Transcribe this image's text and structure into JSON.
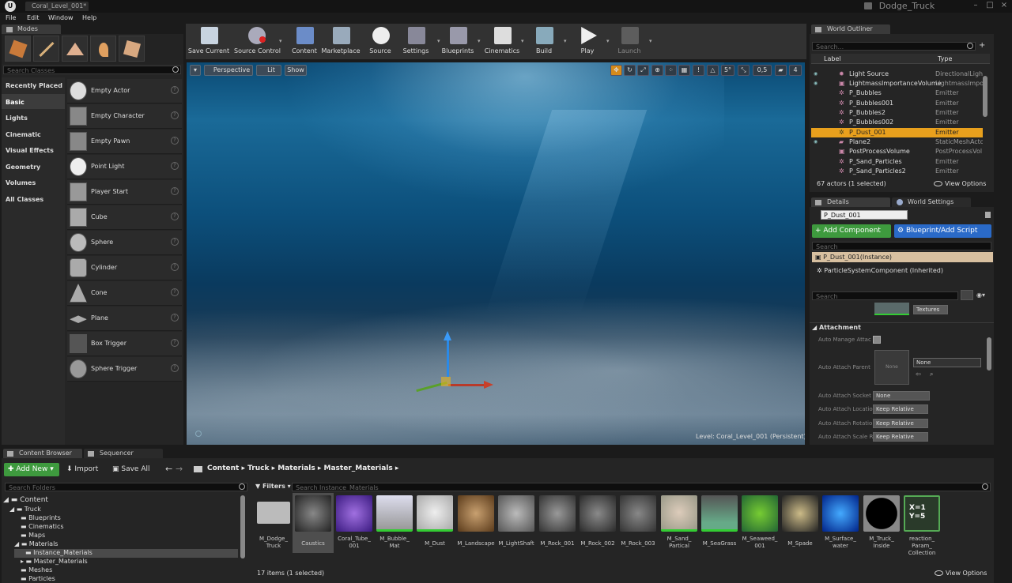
{
  "title_bar": {
    "tab": "Coral_Level_001*",
    "project": "Dodge_Truck"
  },
  "menu": [
    "File",
    "Edit",
    "Window",
    "Help"
  ],
  "modes": {
    "tab": "Modes",
    "search_placeholder": "Search Classes",
    "categories": [
      "Recently Placed",
      "Basic",
      "Lights",
      "Cinematic",
      "Visual Effects",
      "Geometry",
      "Volumes",
      "All Classes"
    ],
    "items": [
      "Empty Actor",
      "Empty Character",
      "Empty Pawn",
      "Point Light",
      "Player Start",
      "Cube",
      "Sphere",
      "Cylinder",
      "Cone",
      "Plane",
      "Box Trigger",
      "Sphere Trigger"
    ]
  },
  "toolbar": [
    "Save Current",
    "Source Control",
    "Content",
    "Marketplace",
    "Source",
    "Settings",
    "Blueprints",
    "Cinematics",
    "Build",
    "Play",
    "Launch"
  ],
  "viewport": {
    "perspective": "Perspective",
    "lit": "Lit",
    "show": "Show",
    "snap_angle": "5°",
    "snap_scale": "0,5",
    "camera_speed": "4",
    "level_label": "Level:",
    "level_name": "Coral_Level_001 (Persistent)"
  },
  "outliner": {
    "tab": "World Outliner",
    "search_placeholder": "Search...",
    "col_label": "Label",
    "col_type": "Type",
    "rows": [
      {
        "name": "Light Source",
        "type": "DirectionalLight",
        "icon": "bulb-icon"
      },
      {
        "name": "LightmassImportanceVolume",
        "type": "LightmassImpo",
        "icon": "cube-icon"
      },
      {
        "name": "P_Bubbles",
        "type": "Emitter",
        "icon": "particle-icon"
      },
      {
        "name": "P_Bubbles001",
        "type": "Emitter",
        "icon": "particle-icon"
      },
      {
        "name": "P_Bubbles2",
        "type": "Emitter",
        "icon": "particle-icon"
      },
      {
        "name": "P_Bubbles002",
        "type": "Emitter",
        "icon": "particle-icon"
      },
      {
        "name": "P_Dust_001",
        "type": "Emitter",
        "icon": "particle-icon"
      },
      {
        "name": "Plane2",
        "type": "StaticMeshActo",
        "icon": "mesh-icon"
      },
      {
        "name": "PostProcessVolume",
        "type": "PostProcessVol",
        "icon": "cube-icon"
      },
      {
        "name": "P_Sand_Particles",
        "type": "Emitter",
        "icon": "particle-icon"
      },
      {
        "name": "P_Sand_Particles2",
        "type": "Emitter",
        "icon": "particle-icon"
      }
    ],
    "count": "67 actors (1 selected)",
    "view_options": "View Options"
  },
  "details": {
    "tab": "Details",
    "tab2": "World Settings",
    "name_value": "P_Dust_001",
    "add_component": "+ Add Component",
    "blueprint_script": "Blueprint/Add Script",
    "search_placeholder": "Search",
    "instance": "P_Dust_001(Instance)",
    "component": "ParticleSystemComponent (Inherited)",
    "search2_placeholder": "Search",
    "textures": "Textures",
    "section": "Attachment",
    "props": [
      {
        "label": "Auto Manage Attac"
      },
      {
        "label": "Auto Attach Parent",
        "thumb": "None",
        "value": "None"
      },
      {
        "label": "Auto Attach Socket",
        "value": "None"
      },
      {
        "label": "Auto Attach Locatio",
        "value": "Keep Relative"
      },
      {
        "label": "Auto Attach Rotatio",
        "value": "Keep Relative"
      },
      {
        "label": "Auto Attach Scale R",
        "value": "Keep Relative"
      }
    ]
  },
  "content_browser": {
    "tab": "Content Browser",
    "tab2": "Sequencer",
    "add_new": "Add New",
    "import": "Import",
    "save_all": "Save All",
    "path": [
      "Content",
      "Truck",
      "Materials",
      "Master_Materials"
    ],
    "folders_placeholder": "Search Folders",
    "filters": "Filters",
    "assets_placeholder": "Search Instance_Materials",
    "tree": [
      {
        "label": "Content",
        "depth": 0
      },
      {
        "label": "Truck",
        "depth": 1
      },
      {
        "label": "Blueprints",
        "depth": 2
      },
      {
        "label": "Cinematics",
        "depth": 2
      },
      {
        "label": "Maps",
        "depth": 2
      },
      {
        "label": "Materials",
        "depth": 2
      },
      {
        "label": "Instance_Materials",
        "depth": 3
      },
      {
        "label": "Master_Materials",
        "depth": 3
      },
      {
        "label": "Meshes",
        "depth": 2
      },
      {
        "label": "Particles",
        "depth": 2
      }
    ],
    "assets": [
      "M_Dodge_\nTruck",
      "Caustics",
      "Coral_Tube_\n001",
      "M_Bubble_\nMat",
      "M_Dust",
      "M_Landscape",
      "M_LightShaft",
      "M_Rock_001",
      "M_Rock_002",
      "M_Rock_003",
      "M_Sand_\nPartical",
      "M_SeaGrass",
      "M_Seaweed_\n001",
      "M_Spade",
      "M_Surface_\nwater",
      "M_Truck_\nInside",
      "reaction_\nParam_\nCollection"
    ],
    "param_text": "X=1\nY=5",
    "count": "17 items (1 selected)",
    "view_options": "View Options"
  }
}
